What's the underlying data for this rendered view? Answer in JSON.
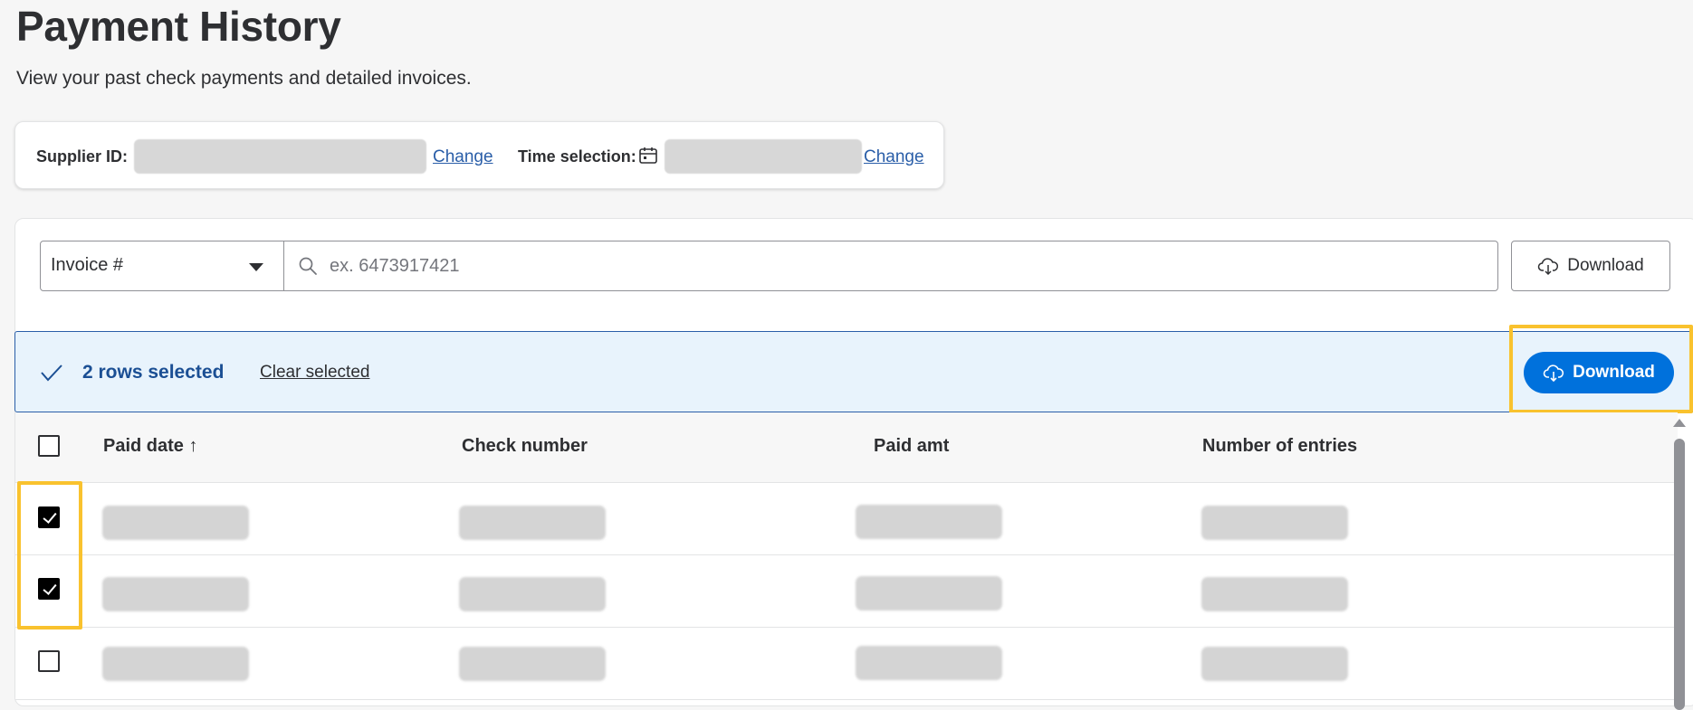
{
  "header": {
    "title": "Payment History",
    "subtitle": "View your past check payments and detailed invoices."
  },
  "filters": {
    "supplier_label": "Supplier ID:",
    "supplier_change": "Change",
    "time_label": "Time selection:",
    "time_change": "Change"
  },
  "search": {
    "type_selected": "Invoice #",
    "placeholder": "ex. 6473917421",
    "download_label": "Download"
  },
  "selection": {
    "count_text": "2 rows selected",
    "clear_label": "Clear selected",
    "download_label": "Download"
  },
  "table": {
    "columns": [
      "Paid date",
      "Check number",
      "Paid amt",
      "Number of entries"
    ],
    "sort_indicator": "↑",
    "rows": [
      {
        "selected": true
      },
      {
        "selected": true
      },
      {
        "selected": false
      }
    ]
  },
  "colors": {
    "primary": "#0071dc",
    "highlight": "#f9c22e",
    "link": "#2a5ea8",
    "selection_bg": "#e8f3fc"
  }
}
